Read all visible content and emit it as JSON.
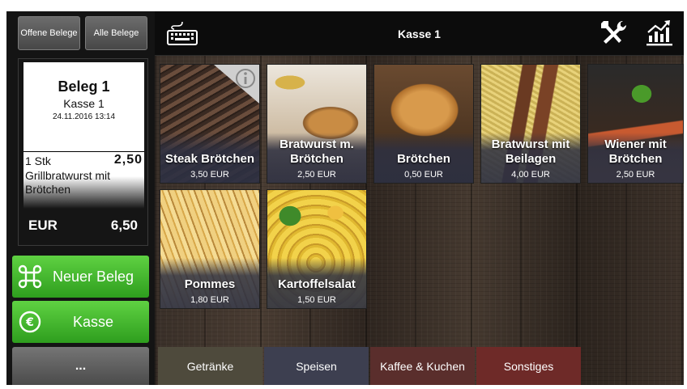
{
  "header": {
    "title": "Kasse 1"
  },
  "left": {
    "open_receipts_label": "Offene Belege",
    "all_receipts_label": "Alle Belege"
  },
  "receipt": {
    "title": "Beleg 1",
    "register": "Kasse 1",
    "datetime": "24.11.2016 13:14",
    "line": {
      "qty": "1 Stk",
      "price": "2,50",
      "item": "Grillbratwurst mit Brötchen"
    },
    "currency": "EUR",
    "total": "6,50"
  },
  "actions": {
    "new_receipt_label": "Neuer Beleg",
    "checkout_label": "Kasse",
    "more_label": "..."
  },
  "products": [
    {
      "name": "Steak Brötchen",
      "price": "3,50 EUR"
    },
    {
      "name": "Bratwurst m. Brötchen",
      "price": "2,50 EUR"
    },
    {
      "name": "Brötchen",
      "price": "0,50 EUR"
    },
    {
      "name": "Bratwurst mit Beilagen",
      "price": "4,00 EUR"
    },
    {
      "name": "Wiener mit Brötchen",
      "price": "2,50 EUR"
    },
    {
      "name": "Pommes",
      "price": "1,80 EUR"
    },
    {
      "name": "Kartoffelsalat",
      "price": "1,50 EUR"
    }
  ],
  "categories": [
    {
      "label": "Getränke",
      "color": "#4e4a3c"
    },
    {
      "label": "Speisen",
      "color": "#3d3f50"
    },
    {
      "label": "Kaffee & Kuchen",
      "color": "#5a2e2c"
    },
    {
      "label": "Sonstiges",
      "color": "#6e2a28"
    }
  ],
  "icons": {
    "keyboard": "keyboard-icon",
    "tools": "tools-icon",
    "stats": "stats-icon",
    "command": "command-icon",
    "euro": "euro-icon",
    "info": "info-icon"
  }
}
